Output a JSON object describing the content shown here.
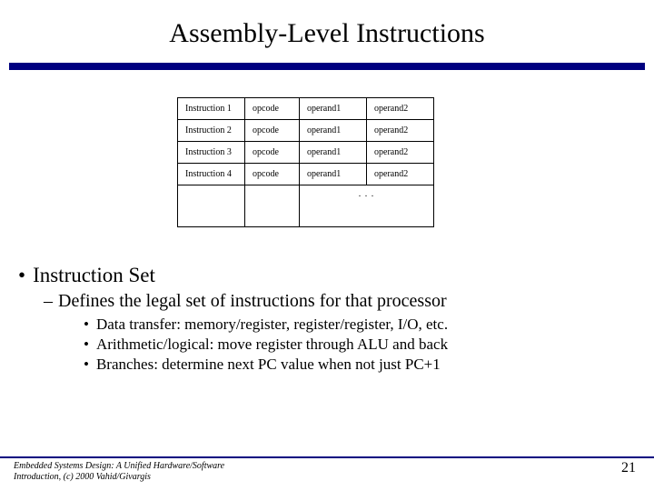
{
  "title": "Assembly-Level Instructions",
  "table": {
    "rows": [
      {
        "c1": "Instruction 1",
        "c2": "opcode",
        "c3": "operand1",
        "c4": "operand2"
      },
      {
        "c1": "Instruction 2",
        "c2": "opcode",
        "c3": "operand1",
        "c4": "operand2"
      },
      {
        "c1": "Instruction 3",
        "c2": "opcode",
        "c3": "operand1",
        "c4": "operand2"
      },
      {
        "c1": "Instruction 4",
        "c2": "opcode",
        "c3": "operand1",
        "c4": "operand2"
      }
    ],
    "ellipsis": ". . ."
  },
  "bullets": {
    "level1": "Instruction Set",
    "level2": "Defines the legal set of instructions for that processor",
    "level3": [
      "Data transfer: memory/register, register/register, I/O, etc.",
      "Arithmetic/logical: move register through ALU and back",
      "Branches: determine next PC value when not just PC+1"
    ]
  },
  "footer": {
    "credit": "Embedded Systems Design: A Unified Hardware/Software Introduction, (c) 2000 Vahid/Givargis",
    "page": "21"
  }
}
